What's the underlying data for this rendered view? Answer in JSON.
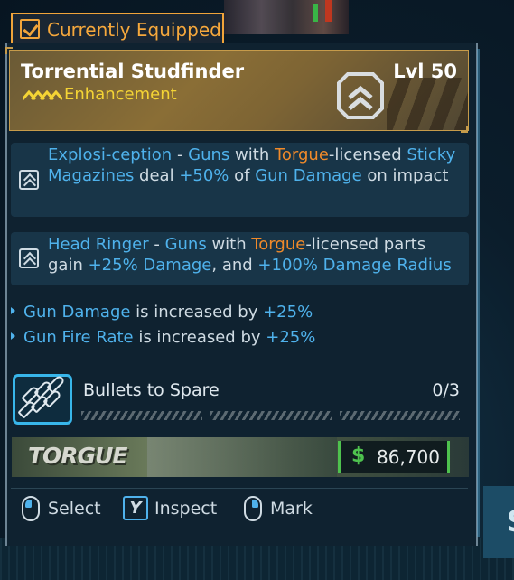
{
  "tab": {
    "label": "Currently Equipped",
    "icon": "equipped-check-icon"
  },
  "item": {
    "name": "Torrential Studfinder",
    "level": "Lvl 50",
    "type": "Enhancement",
    "rarity_icon": "legendary-chevrons-icon",
    "class_icon": "enhancement-chevron-icon",
    "rarity_color": "#f4d435"
  },
  "perks": [
    {
      "icon": "enhancement-perk-icon",
      "parts": [
        {
          "t": "Explosi-ception",
          "c": "blue"
        },
        {
          "t": " - ",
          "c": "plain"
        },
        {
          "t": "Guns",
          "c": "blue"
        },
        {
          "t": " with ",
          "c": "plain"
        },
        {
          "t": "Torgue",
          "c": "orange"
        },
        {
          "t": "-licensed ",
          "c": "plain"
        },
        {
          "t": "Sticky Magazines",
          "c": "blue"
        },
        {
          "t": " deal ",
          "c": "plain"
        },
        {
          "t": "+50%",
          "c": "blue"
        },
        {
          "t": " of ",
          "c": "plain"
        },
        {
          "t": "Gun Damage",
          "c": "blue"
        },
        {
          "t": " on impact",
          "c": "plain"
        }
      ]
    },
    {
      "icon": "enhancement-perk-icon",
      "parts": [
        {
          "t": "Head Ringer",
          "c": "blue"
        },
        {
          "t": " - ",
          "c": "plain"
        },
        {
          "t": "Guns",
          "c": "blue"
        },
        {
          "t": " with ",
          "c": "plain"
        },
        {
          "t": "Torgue",
          "c": "orange"
        },
        {
          "t": "-licensed parts gain ",
          "c": "plain"
        },
        {
          "t": "+25% Damage",
          "c": "blue"
        },
        {
          "t": ", and ",
          "c": "plain"
        },
        {
          "t": "+100% Damage Radius",
          "c": "blue"
        }
      ]
    }
  ],
  "stats": [
    {
      "stat": "Gun Damage",
      "middle": " is increased by ",
      "value": "+25%"
    },
    {
      "stat": "Gun Fire Rate",
      "middle": " is increased by ",
      "value": "+25%"
    }
  ],
  "capacity": {
    "name": "Bullets to Spare",
    "count": "0/3",
    "icon": "bullets-icon",
    "filled": 0,
    "total": 3
  },
  "manufacturer": {
    "name": "TORGUE",
    "logo_icon": "torgue-logo"
  },
  "price": {
    "currency": "$",
    "value": "86,700"
  },
  "controls": [
    {
      "key_icon": "mouse-left-icon",
      "label": "Select"
    },
    {
      "key": "Y",
      "label": "Inspect"
    },
    {
      "key_icon": "mouse-right-icon",
      "label": "Mark"
    }
  ],
  "colors": {
    "accent_orange": "#f6a83c",
    "keyword_blue": "#4fb2ec",
    "manufacturer_orange": "#f08a2a",
    "price_green": "#4ec24e",
    "panel_bg": "#0f2230",
    "perk_bg": "#183548"
  }
}
